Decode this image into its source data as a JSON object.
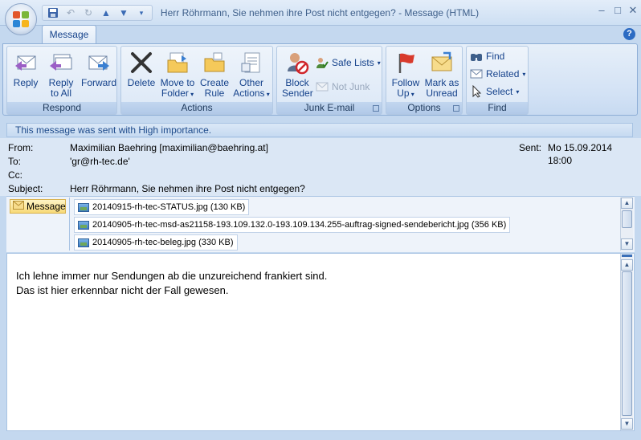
{
  "window": {
    "title": "Herr Röhrmann, Sie nehmen ihre Post nicht entgegen? - Message (HTML)"
  },
  "ribbon": {
    "tab": "Message",
    "groups": {
      "respond": {
        "label": "Respond",
        "reply": "Reply",
        "reply_all_1": "Reply",
        "reply_all_2": "to All",
        "forward": "Forward"
      },
      "actions": {
        "label": "Actions",
        "delete": "Delete",
        "move_1": "Move to",
        "move_2": "Folder",
        "rule_1": "Create",
        "rule_2": "Rule",
        "other_1": "Other",
        "other_2": "Actions"
      },
      "junk": {
        "label": "Junk E-mail",
        "block_1": "Block",
        "block_2": "Sender",
        "safe_lists": "Safe Lists",
        "not_junk": "Not Junk"
      },
      "options": {
        "label": "Options",
        "follow_1": "Follow",
        "follow_2": "Up",
        "mark_1": "Mark as",
        "mark_2": "Unread"
      },
      "find": {
        "label": "Find",
        "find": "Find",
        "related": "Related",
        "select": "Select"
      }
    }
  },
  "infobar": "This message was sent with High importance.",
  "header": {
    "from_label": "From:",
    "from": "Maximilian Baehring [maximilian@baehring.at]",
    "sent_label": "Sent:",
    "sent": "Mo 15.09.2014 18:00",
    "to_label": "To:",
    "to": "'gr@rh-tec.de'",
    "cc_label": "Cc:",
    "cc": "",
    "subject_label": "Subject:",
    "subject": "Herr Röhrmann, Sie nehmen ihre Post nicht entgegen?"
  },
  "attachments": {
    "message_tab": "Message",
    "items": [
      "20140915-rh-tec-STATUS.jpg (130 KB)",
      "20140905-rh-tec-msd-as21158-193.109.132.0-193.109.134.255-auftrag-signed-sendebericht.jpg (356 KB)",
      "20140905-rh-tec-beleg.jpg (330 KB)"
    ]
  },
  "body": {
    "line1": "Ich lehne immer nur Sendungen ab die unzureichend frankiert sind.",
    "line2": "Das ist hier erkennbar nicht der Fall gewesen."
  },
  "colors": {
    "accent": "#15428b",
    "ribbon_bg": "#d3e2f5",
    "window_bg": "#c4d8ef"
  }
}
